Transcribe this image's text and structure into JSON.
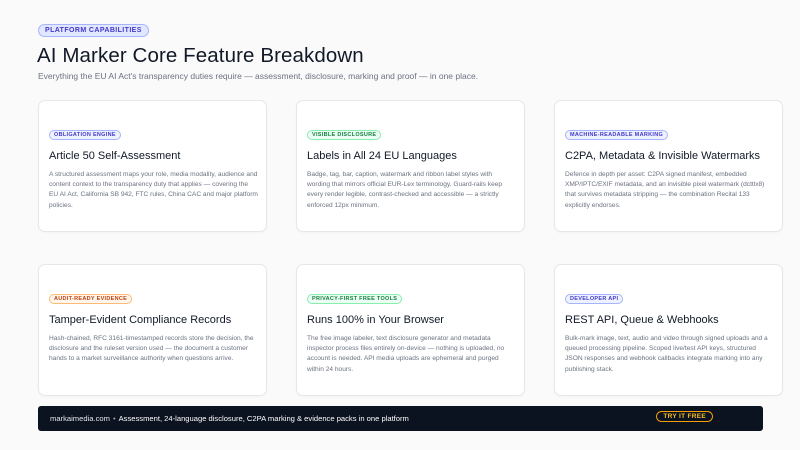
{
  "header": {
    "eyebrow": "PLATFORM CAPABILITIES",
    "title": "AI Marker Core Feature Breakdown",
    "subtitle": "Everything the EU AI Act's transparency duties require — assessment, disclosure, marking and proof — in one place."
  },
  "cards": [
    {
      "badge": "OBLIGATION ENGINE",
      "badge_color": "#4338ca",
      "title": "Article 50 Self-Assessment",
      "desc": "A structured assessment maps your role, media modality, audience and content context to the transparency duty that applies — covering the EU AI Act, California SB 942, FTC rules, China CAC and major platform policies."
    },
    {
      "badge": "VISIBLE DISCLOSURE",
      "badge_color": "#15803d",
      "title": "Labels in All 24 EU Languages",
      "desc": "Badge, tag, bar, caption, watermark and ribbon label styles with wording that mirrors official EUR-Lex terminology. Guard-rails keep every render legible, contrast-checked and accessible — a strictly enforced 12px minimum."
    },
    {
      "badge": "MACHINE-READABLE MARKING",
      "badge_color": "#4338ca",
      "title": "C2PA, Metadata & Invisible Watermarks",
      "desc": "Defence in depth per asset: C2PA signed manifest, embedded XMP/IPTC/EXIF metadata, and an invisible pixel watermark (dcttlx8) that survives metadata stripping — the combination Recital 133 explicitly endorses."
    },
    {
      "badge": "AUDIT-READY EVIDENCE",
      "badge_color": "#c2410c",
      "title": "Tamper-Evident Compliance Records",
      "desc": "Hash-chained, RFC 3161-timestamped records store the decision, the disclosure and the ruleset version used — the document a customer hands to a market surveillance authority when questions arrive."
    },
    {
      "badge": "PRIVACY-FIRST FREE TOOLS",
      "badge_color": "#15803d",
      "title": "Runs 100% in Your Browser",
      "desc": "The free image labeler, text disclosure generator and metadata inspector process files entirely on-device — nothing is uploaded, no account is needed. API media uploads are ephemeral and purged within 24 hours."
    },
    {
      "badge": "DEVELOPER API",
      "badge_color": "#4338ca",
      "title": "REST API, Queue & Webhooks",
      "desc": "Bulk-mark image, text, audio and video through signed uploads and a queued processing pipeline. Scoped live/test API keys, structured JSON responses and webhook callbacks integrate marking into any publishing stack."
    }
  ],
  "footer": {
    "domain": "markaimedia.com",
    "separator": "•",
    "tagline": "Assessment, 24-language disclosure, C2PA marking & evidence packs in one platform",
    "cta": "TRY IT FREE"
  }
}
